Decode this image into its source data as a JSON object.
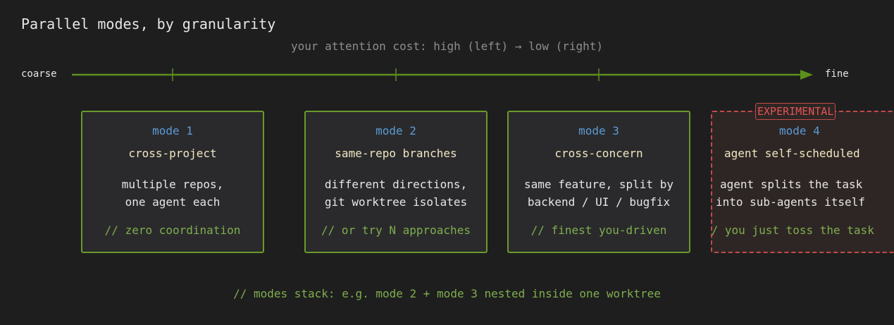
{
  "title": "Parallel modes, by granularity",
  "subtitle": "your attention cost: high (left) → low (right)",
  "axis": {
    "left_label": "coarse",
    "right_label": "fine",
    "color": "#5c8f1c"
  },
  "modes": [
    {
      "mode_label": "mode 1",
      "name": "cross-project",
      "desc_line1": "multiple repos,",
      "desc_line2": "one agent each",
      "note": "// zero coordination"
    },
    {
      "mode_label": "mode 2",
      "name": "same-repo branches",
      "desc_line1": "different directions,",
      "desc_line2": "git worktree isolates",
      "note": "// or try N approaches"
    },
    {
      "mode_label": "mode 3",
      "name": "cross-concern",
      "desc_line1": "same feature, split by",
      "desc_line2": "backend / UI / bugfix",
      "note": "// finest you-driven"
    },
    {
      "mode_label": "mode 4",
      "badge": "EXPERIMENTAL",
      "name": "agent self-scheduled",
      "desc_line1": "agent splits the task",
      "desc_line2": "into sub-agents itself",
      "note": "// you just toss the task"
    }
  ],
  "footer": "// modes stack: e.g. mode 2 + mode 3 nested inside one worktree",
  "colors": {
    "background": "#1e1e1e",
    "card_border": "#6a9a2a",
    "mode_label": "#5b9bd5",
    "mode_name": "#f0e6c2",
    "note": "#7fae4e",
    "experimental": "#c24a4a"
  }
}
